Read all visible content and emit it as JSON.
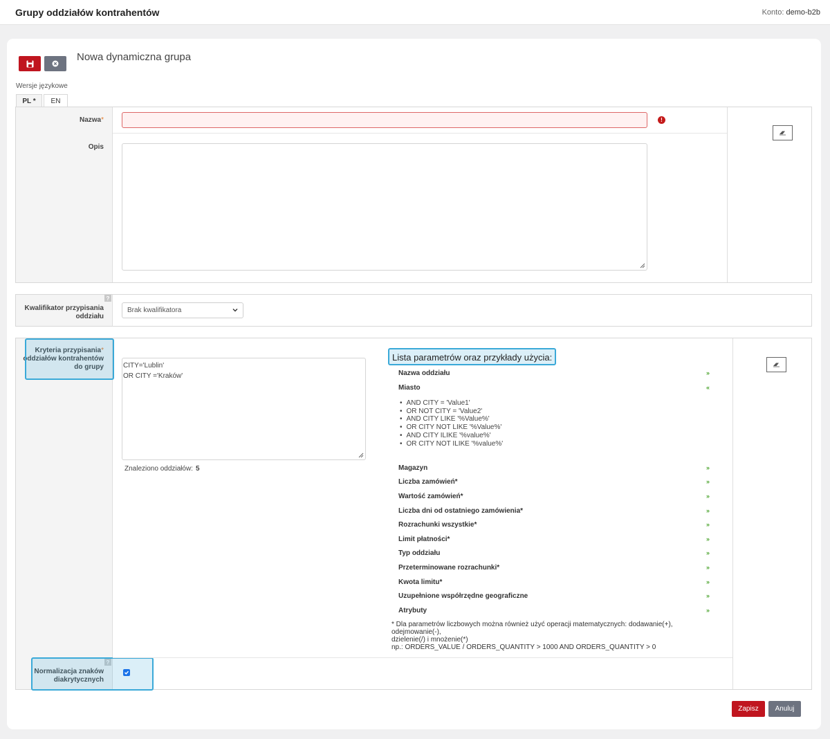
{
  "header": {
    "title": "Grupy oddziałów kontrahentów",
    "account_label": "Konto:",
    "account_value": "demo-b2b"
  },
  "toolbar": {
    "save_icon": "save-icon",
    "cancel_icon": "close-circle-icon"
  },
  "form": {
    "title": "Nowa dynamiczna grupa",
    "language_versions_label": "Wersje językowe",
    "tabs": [
      {
        "label": "PL *"
      },
      {
        "label": "EN"
      }
    ],
    "name_label": "Nazwa",
    "required_mark": "*",
    "name_value": "",
    "description_label": "Opis",
    "description_value": "",
    "qualifier_label_1": "Kwalifikator przypisania",
    "qualifier_label_2": "oddziału",
    "qualifier_value": "Brak kwalifikatora",
    "help_mark": "?",
    "criteria_label_1": "Kryteria przypisania",
    "criteria_label_2": "oddziałów kontrahentów",
    "criteria_label_3": "do grupy",
    "criteria_lines": [
      "CITY='Lublin'",
      "OR CITY ='Kraków'"
    ],
    "found_label": "Znaleziono oddziałów:",
    "found_count": "5",
    "params_title": "Lista parametrów oraz przykłady użycia:",
    "params": [
      "Nazwa oddziału",
      "Miasto",
      "Magazyn",
      "Liczba zamówień*",
      "Wartość zamówień*",
      "Liczba dni od ostatniego zamówienia*",
      "Rozrachunki wszystkie*",
      "Limit płatności*",
      "Typ oddziału",
      "Przeterminowane rozrachunki*",
      "Kwota limitu*",
      "Uzupełnione współrzędne geograficzne",
      "Atrybuty"
    ],
    "city_examples": [
      "AND CITY = 'Value1'",
      "OR NOT CITY = 'Value2'",
      "AND CITY LIKE '%Value%'",
      "OR CITY NOT LIKE '%Value%'",
      "AND CITY ILIKE '%value%'",
      "OR CITY NOT ILIKE '%value%'"
    ],
    "note_line1": "* Dla parametrów liczbowych można również użyć operacji matematycznych: dodawanie(+), odejmowanie(-),",
    "note_line2": "dzielenie(/) i mnożenie(*)",
    "note_line3": "np.: ORDERS_VALUE / ORDERS_QUANTITY > 1000 AND ORDERS_QUANTITY > 0",
    "normalization_label_1": "Normalizacja znaków",
    "normalization_label_2": "diakrytycznych",
    "normalization_checked": true
  },
  "actions": {
    "save_label": "Zapisz",
    "cancel_label": "Anuluj"
  },
  "colors": {
    "primary": "#c0151f",
    "secondary": "#6d7380",
    "highlight": "#3aa9d8",
    "expand": "#4aa32c"
  }
}
